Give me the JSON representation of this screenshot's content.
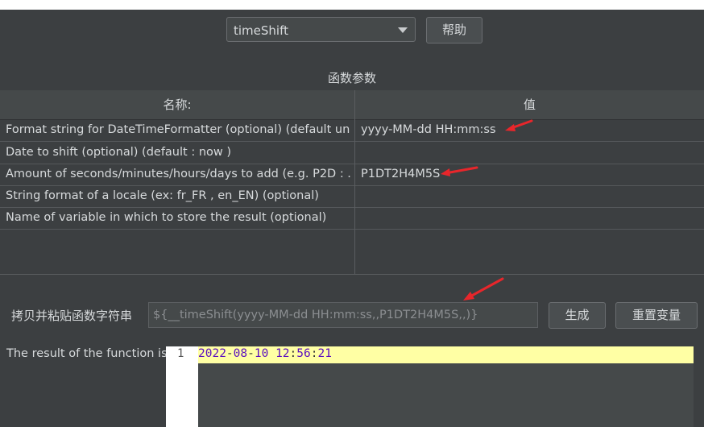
{
  "function_select": {
    "value": "timeShift"
  },
  "help_button": {
    "label": "帮助"
  },
  "section_title": "函数参数",
  "table": {
    "headers": {
      "name": "名称:",
      "value": "值"
    },
    "rows": [
      {
        "name": "Format string for DateTimeFormatter (optional) (default un...",
        "value": "yyyy-MM-dd HH:mm:ss"
      },
      {
        "name": "Date to shift (optional) (default : now )",
        "value": ""
      },
      {
        "name": "Amount of seconds/minutes/hours/days to add (e.g. P2D : ...",
        "value": "P1DT2H4M5S"
      },
      {
        "name": "String format of a locale (ex: fr_FR , en_EN) (optional)",
        "value": ""
      },
      {
        "name": "Name of variable in which to store the result (optional)",
        "value": ""
      }
    ]
  },
  "copy_row": {
    "label": "拷贝并粘贴函数字符串",
    "function_string": "${__timeShift(yyyy-MM-dd HH:mm:ss,,P1DT2H4M5S,,)}",
    "generate_label": "生成",
    "reset_label": "重置变量"
  },
  "result": {
    "label": "The result of the function is",
    "line_number": "1",
    "tokens": {
      "year": "2022",
      "sep1": "-",
      "month": "08",
      "sep2": "-",
      "day": "10",
      "space": " ",
      "hour": "12",
      "colon1": ":",
      "minute": "56",
      "colon2": ":",
      "second": "21"
    }
  },
  "colors": {
    "panel": "#3c3f41",
    "arrow": "#e8262b",
    "highlight": "#ffffa4"
  }
}
